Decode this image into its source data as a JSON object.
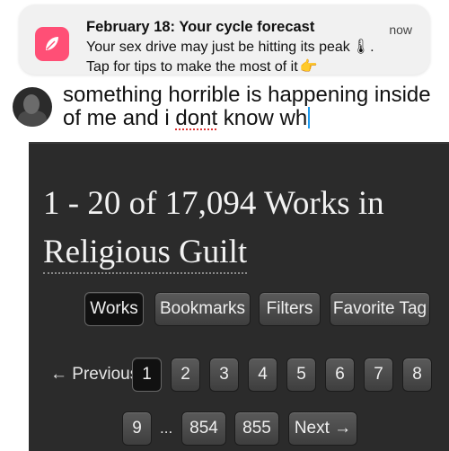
{
  "notification": {
    "app_icon": "period-tracker-app-icon",
    "title": "February 18: Your cycle forecast",
    "time": "now",
    "line1": "Your sex drive may just be hitting its peak",
    "line1_emoji": "🌡",
    "line1_end": ".",
    "line2": "Tap for tips to make the most of it",
    "line2_emoji": "👉"
  },
  "tweet": {
    "avatar": "user-avatar",
    "text_before": "something horrible is happening inside of me and i ",
    "misspelled_word": "dont",
    "text_after": " know wh"
  },
  "ao3": {
    "heading_line1": "1 - 20 of 17,094 Works in",
    "heading_line2": "Religious Guilt",
    "nav_buttons": [
      "Works",
      "Bookmarks",
      "Filters",
      "Favorite Tag"
    ],
    "active_nav": "Works",
    "pagination": {
      "previous": "← Previous",
      "pages_row1": [
        "1",
        "2",
        "3",
        "4",
        "5",
        "6",
        "7",
        "8"
      ],
      "current_page": "1",
      "pages_row2": [
        "9",
        "854",
        "855"
      ],
      "ellipsis": "...",
      "next": "Next →"
    }
  },
  "colors": {
    "app_icon_bg": "#ff4f76",
    "panel_bg": "#2b2b2b",
    "caret": "#1d9bf0"
  }
}
